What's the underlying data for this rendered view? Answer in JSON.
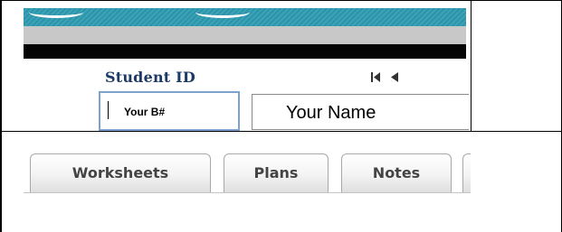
{
  "student": {
    "id_label": "Student ID",
    "id_value": "Your B#",
    "name_value": "Your Name"
  },
  "navigation": {
    "first_icon": "first-record-icon",
    "prev_icon": "previous-record-icon"
  },
  "tabs": [
    {
      "label": "Worksheets"
    },
    {
      "label": "Plans"
    },
    {
      "label": "Notes"
    },
    {
      "label": ""
    }
  ],
  "colors": {
    "banner_teal": "#2c93a8",
    "banner_gray": "#c8c8c8",
    "banner_black": "#050505",
    "label_navy": "#1b3a66",
    "focus_border": "#7da2ce",
    "tab_text": "#444444"
  }
}
